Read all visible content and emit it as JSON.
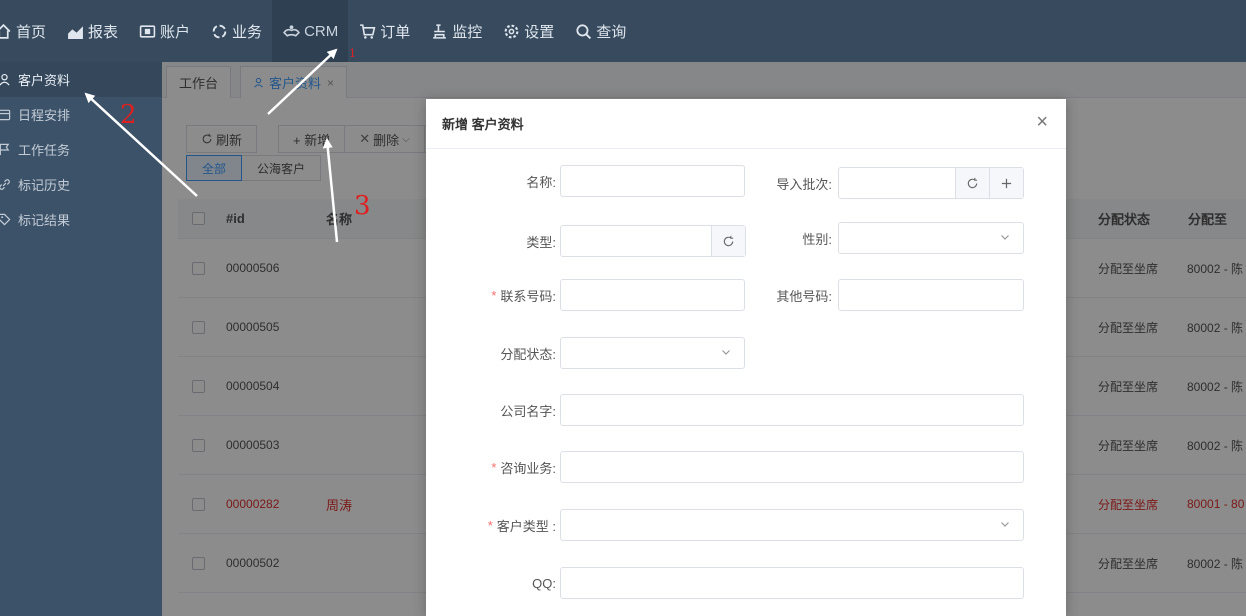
{
  "topnav": {
    "items": [
      {
        "label": "首页",
        "icon": "home-icon"
      },
      {
        "label": "报表",
        "icon": "chart-icon"
      },
      {
        "label": "账户",
        "icon": "account-icon"
      },
      {
        "label": "业务",
        "icon": "business-icon"
      },
      {
        "label": "CRM",
        "icon": "handshake-icon",
        "active": true
      },
      {
        "label": "订单",
        "icon": "cart-icon"
      },
      {
        "label": "监控",
        "icon": "monitor-icon"
      },
      {
        "label": "设置",
        "icon": "gear-icon"
      },
      {
        "label": "查询",
        "icon": "search-icon"
      }
    ]
  },
  "sidebar": {
    "items": [
      {
        "label": "客户资料",
        "icon": "user-icon",
        "active": true
      },
      {
        "label": "日程安排",
        "icon": "calendar-icon"
      },
      {
        "label": "工作任务",
        "icon": "flag-icon"
      },
      {
        "label": "标记历史",
        "icon": "link-icon"
      },
      {
        "label": "标记结果",
        "icon": "tag-icon"
      }
    ]
  },
  "tabs": [
    {
      "label": "工作台"
    },
    {
      "label": "客户资料",
      "close": "×"
    }
  ],
  "toolbar": {
    "refresh": "刷新",
    "add": "+ 新增",
    "delete": "删除"
  },
  "subtabs": [
    "全部",
    "公海客户"
  ],
  "table": {
    "headers": {
      "id": "#id",
      "name": "名称",
      "status": "分配状态",
      "assign": "分配至"
    },
    "rows": [
      {
        "id": "00000506",
        "name": "",
        "status": "分配至坐席",
        "assign": "80002 - 陈",
        "red": false
      },
      {
        "id": "00000505",
        "name": "",
        "status": "分配至坐席",
        "assign": "80002 - 陈",
        "red": false
      },
      {
        "id": "00000504",
        "name": "",
        "status": "分配至坐席",
        "assign": "80002 - 陈",
        "red": false
      },
      {
        "id": "00000503",
        "name": "",
        "status": "分配至坐席",
        "assign": "80002 - 陈",
        "red": false
      },
      {
        "id": "00000282",
        "name": "周涛",
        "status": "分配至坐席",
        "assign": "80001 - 80",
        "red": true
      },
      {
        "id": "00000502",
        "name": "",
        "status": "分配至坐席",
        "assign": "80002 - 陈",
        "red": false
      }
    ]
  },
  "modal": {
    "title": "新增 客户资料",
    "close": "×",
    "fields": {
      "name": "名称:",
      "batch": "导入批次:",
      "type": "类型:",
      "gender": "性别:",
      "phone": "联系号码:",
      "other_phone": "其他号码:",
      "assign_status": "分配状态:",
      "company": "公司名字:",
      "consult": "咨询业务:",
      "cust_type": "客户类型 :",
      "qq": "QQ:"
    },
    "required_mark": "*"
  },
  "annotations": [
    "1",
    "2",
    "3"
  ],
  "colors": {
    "topnav": "#374a5e",
    "sidebar": "#3c5269",
    "accent": "#409eff",
    "required": "#f56c6c",
    "annotation": "#e02020",
    "highlight_row": "#e0312f"
  }
}
